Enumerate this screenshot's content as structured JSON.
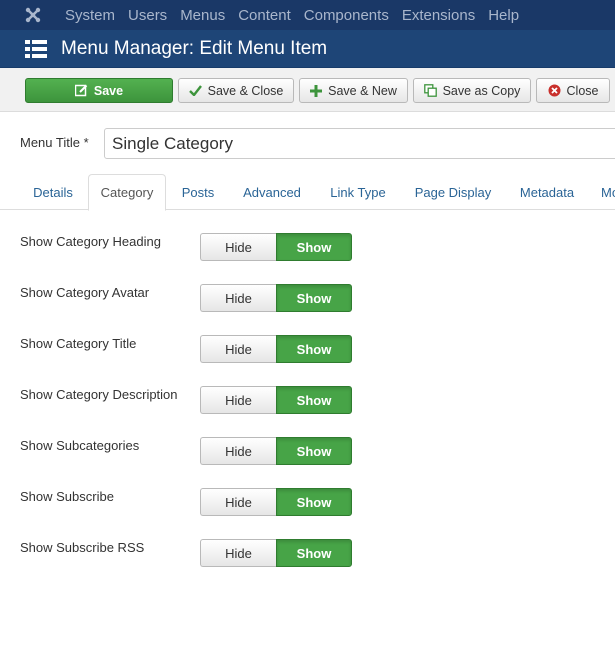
{
  "topnav": {
    "logo_icon": "joomla-logo-icon",
    "items": [
      "System",
      "Users",
      "Menus",
      "Content",
      "Components",
      "Extensions",
      "Help"
    ]
  },
  "header": {
    "icon": "list-icon",
    "title": "Menu Manager: Edit Menu Item"
  },
  "toolbar": {
    "save": "Save",
    "save_close": "Save & Close",
    "save_new": "Save & New",
    "save_copy": "Save as Copy",
    "close": "Close"
  },
  "form": {
    "title_label": "Menu Title *",
    "title_value": "Single Category"
  },
  "tabs": [
    "Details",
    "Category",
    "Posts",
    "Advanced",
    "Link Type",
    "Page Display",
    "Metadata",
    "Mo"
  ],
  "active_tab": "Category",
  "options": [
    {
      "label": "Show Category Heading",
      "hide": "Hide",
      "show": "Show",
      "selected": "Show"
    },
    {
      "label": "Show Category Avatar",
      "hide": "Hide",
      "show": "Show",
      "selected": "Show"
    },
    {
      "label": "Show Category Title",
      "hide": "Hide",
      "show": "Show",
      "selected": "Show"
    },
    {
      "label": "Show Category Description",
      "hide": "Hide",
      "show": "Show",
      "selected": "Show"
    },
    {
      "label": "Show Subcategories",
      "hide": "Hide",
      "show": "Show",
      "selected": "Show"
    },
    {
      "label": "Show Subscribe",
      "hide": "Hide",
      "show": "Show",
      "selected": "Show"
    },
    {
      "label": "Show Subscribe RSS",
      "hide": "Hide",
      "show": "Show",
      "selected": "Show"
    }
  ],
  "colors": {
    "nav_bg": "#1a3867",
    "header_bg": "#1e4577",
    "save_green": "#47a447",
    "link_blue": "#2a6496"
  }
}
